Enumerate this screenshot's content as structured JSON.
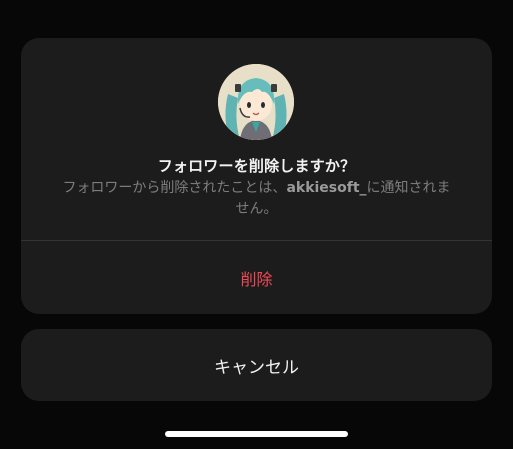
{
  "dialog": {
    "title": "フォロワーを削除しますか？",
    "description_prefix": "フォロワーから削除されたことは、",
    "username": "akkiesoft_",
    "description_suffix": "に通知されません。",
    "delete_label": "削除",
    "cancel_label": "キャンセル"
  },
  "colors": {
    "background": "#070707",
    "sheet": "#1c1c1c",
    "destructive": "#ed4956",
    "secondary_text": "#7d7d7d"
  },
  "icons": {
    "avatar": "profile-avatar-illustration"
  }
}
